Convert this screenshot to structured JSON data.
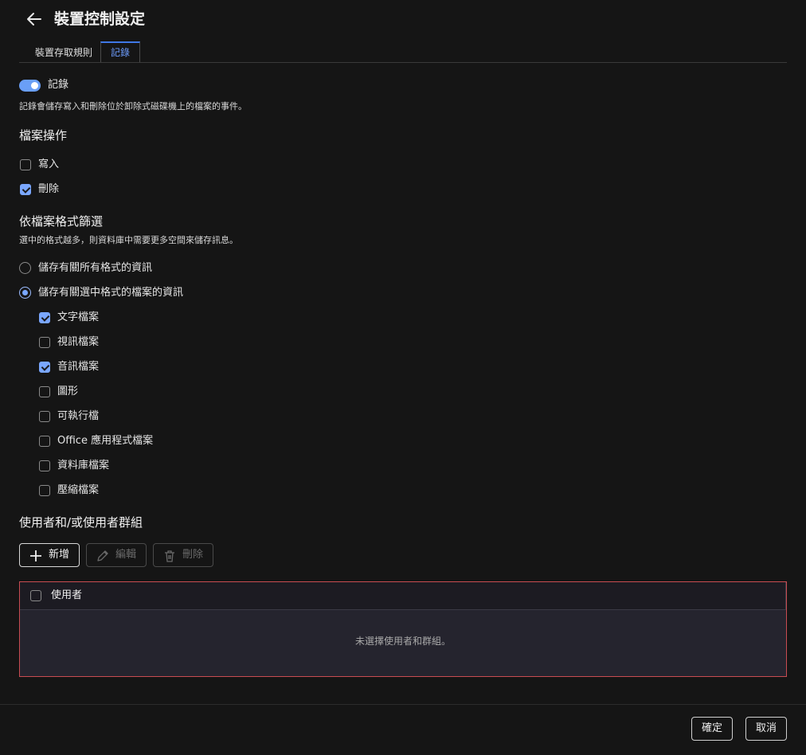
{
  "header": {
    "title": "裝置控制設定",
    "back_icon": "arrow-left-icon"
  },
  "tabs": [
    {
      "label": "裝置存取規則",
      "active": false
    },
    {
      "label": "記錄",
      "active": true
    }
  ],
  "logging": {
    "toggle_label": "記錄",
    "toggle_on": true,
    "description": "記錄會儲存寫入和刪除位於卸除式磁碟機上的檔案的事件。"
  },
  "file_ops": {
    "heading": "檔案操作",
    "items": [
      {
        "label": "寫入",
        "checked": false
      },
      {
        "label": "刪除",
        "checked": true
      }
    ]
  },
  "format_filter": {
    "heading": "依檔案格式篩選",
    "description": "選中的格式越多，則資料庫中需要更多空間來儲存訊息。",
    "radios": [
      {
        "label": "儲存有關所有格式的資訊",
        "selected": false
      },
      {
        "label": "儲存有關選中格式的檔案的資訊",
        "selected": true
      }
    ],
    "formats": [
      {
        "label": "文字檔案",
        "checked": true
      },
      {
        "label": "視訊檔案",
        "checked": false
      },
      {
        "label": "音訊檔案",
        "checked": true
      },
      {
        "label": "圖形",
        "checked": false
      },
      {
        "label": "可執行檔",
        "checked": false
      },
      {
        "label": "Office 應用程式檔案",
        "checked": false
      },
      {
        "label": "資料庫檔案",
        "checked": false
      },
      {
        "label": "壓縮檔案",
        "checked": false
      }
    ]
  },
  "users": {
    "heading": "使用者和/或使用者群組",
    "add_label": "新增",
    "edit_label": "編輯",
    "delete_label": "刪除",
    "column_header": "使用者",
    "empty_text": "未選擇使用者和群組。"
  },
  "footer": {
    "ok_label": "確定",
    "cancel_label": "取消"
  },
  "colors": {
    "accent": "#7aa7ff",
    "error_border": "#c94c52",
    "background": "#151515"
  }
}
